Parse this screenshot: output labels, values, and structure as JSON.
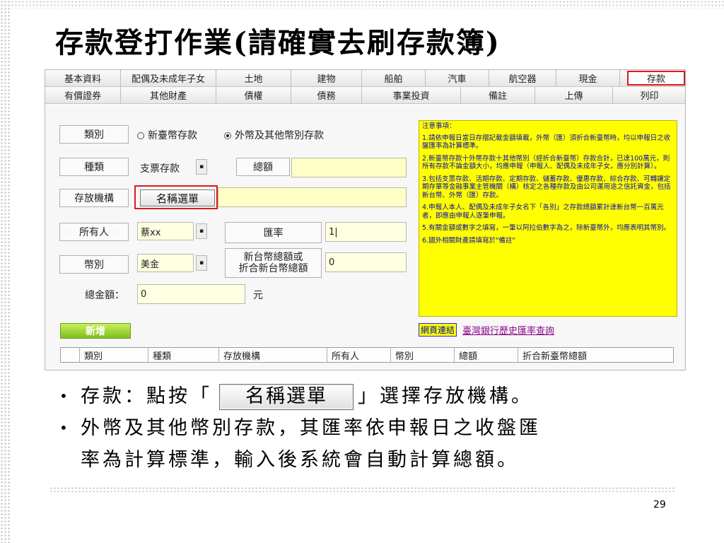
{
  "title": "存款登打作業(請確實去刷存款簿)",
  "tabs_row1": [
    "基本資料",
    "配偶及未成年子女",
    "土地",
    "建物",
    "船舶",
    "汽車",
    "航空器",
    "現金",
    "存款"
  ],
  "tabs_row2": [
    "有價證券",
    "其他財產",
    "債權",
    "債務",
    "事業投資",
    "備註",
    "上傳",
    "列印"
  ],
  "form": {
    "category_label": "類別",
    "radio_ntd": "新臺幣存款",
    "radio_foreign": "外幣及其他幣別存款",
    "type_label": "種類",
    "type_value": "支票存款",
    "total_label": "總額",
    "institution_label": "存放機構",
    "name_select_button": "名稱選單",
    "owner_label": "所有人",
    "owner_value": "蔡xx",
    "rate_label": "匯率",
    "rate_value": "1|",
    "currency_label": "幣別",
    "currency_value": "美金",
    "ntd_total_label_1": "新台幣總額或",
    "ntd_total_label_2": "折合新台幣總額",
    "ntd_total_value": "0",
    "grand_total_label": "總金額：",
    "grand_total_value": "0",
    "grand_total_unit": "元",
    "dropdown_glyph": "▪",
    "add_button": "新增"
  },
  "notes": {
    "title": "注意事項：",
    "items": [
      "1.請依申報日當日存摺記載金額填載，外幣（匯）須折合新臺幣時，均以申報日之收盤匯率為計算標準。",
      "2.新臺幣存款十外幣存款十其他幣別（經折合新臺幣）存款合計，已達100萬元，則所有存款不論金額大小，均應申報（申報人、配偶及未成年子女，應分別計算）。",
      "3.包括支票存款、活期存款、定期存款、儲蓄存款、優惠存款、綜合存款、可轉讓定期存單等金融事業主管機關（構）核定之各種存款及由公司運用途之信託資金，包括新台幣、外幣（匯）存款。",
      "4.申報人本人、配偶及未成年子女名下「各別」之存款總額累計達新台幣一百萬元者，即應由申報人逐筆申報。",
      "5.有關金額或數字之填寫，一筆以阿拉伯數字為之，除新臺幣外，均應表明其幣別。",
      "6.國外相關財產請填寫於\"備註\""
    ],
    "link_box": "網頁連結",
    "link_text": "臺灣銀行歷史匯率查詢"
  },
  "table_headers": [
    "類別",
    "種類",
    "存放機構",
    "所有人",
    "幣別",
    "總額",
    "折合新臺幣總額"
  ],
  "bullets": {
    "b1_prefix": "存款：點按「",
    "b1_button": "名稱選單",
    "b1_suffix": "」選擇存放機構。",
    "b2_line1": "外幣及其他幣別存款，其匯率依申報日之收盤匯",
    "b2_line2": "率為計算標準，輸入後系統會自動計算總額。",
    "bullet_glyph": "•"
  },
  "page_number": "29",
  "colors": {
    "highlight_red": "#e0181b",
    "notes_yellow": "#ffff00",
    "input_yellow": "#ffffc8",
    "add_green": "#8fcf25"
  }
}
